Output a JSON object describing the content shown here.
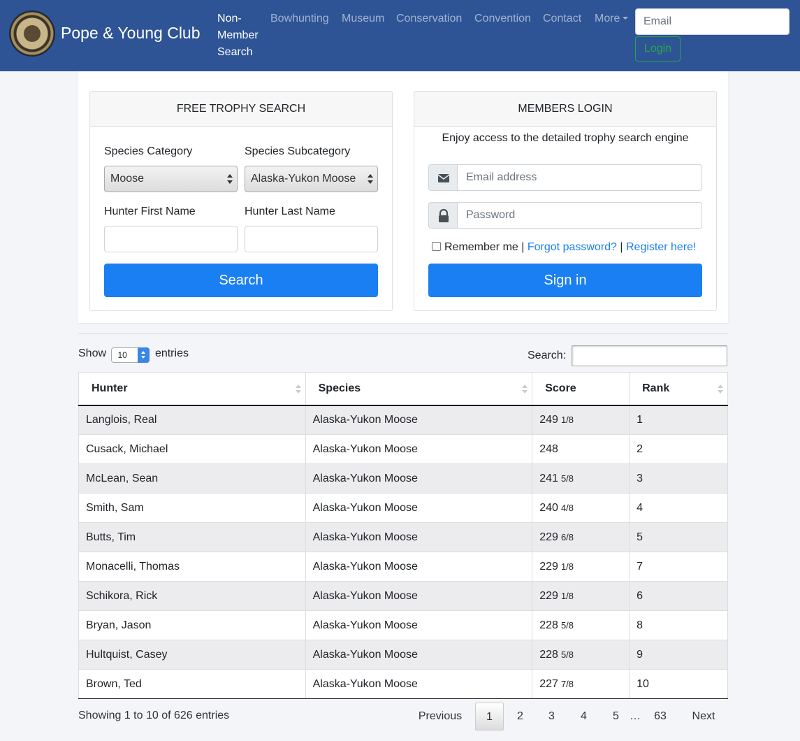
{
  "nav": {
    "brand": "Pope & Young Club",
    "active": "Non-Member Search",
    "links": [
      "Bowhunting",
      "Museum",
      "Conservation",
      "Convention",
      "Contact",
      "More"
    ],
    "email_placeholder": "Email",
    "login": "Login"
  },
  "trophy_search": {
    "header": "FREE TROPHY SEARCH",
    "category_label": "Species Category",
    "category_value": "Moose",
    "subcategory_label": "Species Subcategory",
    "subcategory_value": "Alaska-Yukon Moose",
    "first_name_label": "Hunter First Name",
    "last_name_label": "Hunter Last Name",
    "search_button": "Search"
  },
  "members_login": {
    "header": "MEMBERS LOGIN",
    "intro": "Enjoy access to the detailed trophy search engine",
    "email_placeholder": "Email address",
    "password_placeholder": "Password",
    "remember": "Remember me",
    "separator": "|",
    "forgot": "Forgot password?",
    "register": "Register here!",
    "sign_in": "Sign in"
  },
  "table_controls": {
    "show": "Show",
    "length": "10",
    "entries": "entries",
    "search_label": "Search:"
  },
  "table": {
    "headers": [
      "Hunter",
      "Species",
      "Score",
      "Rank"
    ],
    "rows": [
      {
        "hunter": "Langlois, Real",
        "species": "Alaska-Yukon Moose",
        "score": "249",
        "frac": "1/8",
        "rank": "1"
      },
      {
        "hunter": "Cusack, Michael",
        "species": "Alaska-Yukon Moose",
        "score": "248",
        "frac": "",
        "rank": "2"
      },
      {
        "hunter": "McLean, Sean",
        "species": "Alaska-Yukon Moose",
        "score": "241",
        "frac": "5/8",
        "rank": "3"
      },
      {
        "hunter": "Smith, Sam",
        "species": "Alaska-Yukon Moose",
        "score": "240",
        "frac": "4/8",
        "rank": "4"
      },
      {
        "hunter": "Butts, Tim",
        "species": "Alaska-Yukon Moose",
        "score": "229",
        "frac": "6/8",
        "rank": "5"
      },
      {
        "hunter": "Monacelli, Thomas",
        "species": "Alaska-Yukon Moose",
        "score": "229",
        "frac": "1/8",
        "rank": "7"
      },
      {
        "hunter": "Schikora, Rick",
        "species": "Alaska-Yukon Moose",
        "score": "229",
        "frac": "1/8",
        "rank": "6"
      },
      {
        "hunter": "Bryan, Jason",
        "species": "Alaska-Yukon Moose",
        "score": "228",
        "frac": "5/8",
        "rank": "8"
      },
      {
        "hunter": "Hultquist, Casey",
        "species": "Alaska-Yukon Moose",
        "score": "228",
        "frac": "5/8",
        "rank": "9"
      },
      {
        "hunter": "Brown, Ted",
        "species": "Alaska-Yukon Moose",
        "score": "227",
        "frac": "7/8",
        "rank": "10"
      }
    ]
  },
  "footer": {
    "info": "Showing 1 to 10 of 626 entries",
    "previous": "Previous",
    "pages": [
      "1",
      "2",
      "3",
      "4",
      "5"
    ],
    "ellipsis": "…",
    "last_page": "63",
    "next": "Next"
  }
}
